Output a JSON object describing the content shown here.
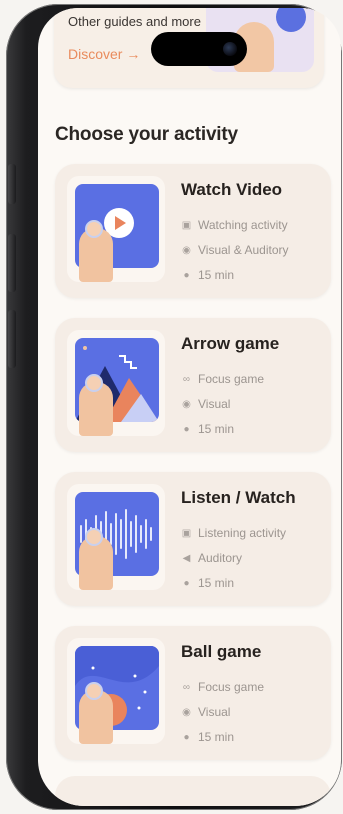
{
  "top_card": {
    "cut_text": "Other guides and more",
    "discover_label": "Discover",
    "arrow_icon": "arrow-right-icon"
  },
  "section_title": "Choose your activity",
  "activities": [
    {
      "title": "Watch Video",
      "thumbnail_icon": "play-video-icon",
      "meta": [
        {
          "icon": "activity-icon",
          "text": "Watching activity"
        },
        {
          "icon": "sense-icon",
          "text": "Visual & Auditory"
        },
        {
          "icon": "clock-icon",
          "text": "15 min"
        }
      ]
    },
    {
      "title": "Arrow game",
      "thumbnail_icon": "mountains-illustration",
      "meta": [
        {
          "icon": "gamepad-icon",
          "text": "Focus game"
        },
        {
          "icon": "sense-icon",
          "text": "Visual"
        },
        {
          "icon": "clock-icon",
          "text": "15 min"
        }
      ]
    },
    {
      "title": "Listen / Watch",
      "thumbnail_icon": "waveform-illustration",
      "meta": [
        {
          "icon": "activity-icon",
          "text": "Listening activity"
        },
        {
          "icon": "speaker-icon",
          "text": "Auditory"
        },
        {
          "icon": "clock-icon",
          "text": "15 min"
        }
      ]
    },
    {
      "title": "Ball game",
      "thumbnail_icon": "ball-illustration",
      "meta": [
        {
          "icon": "gamepad-icon",
          "text": "Focus game"
        },
        {
          "icon": "sense-icon",
          "text": "Visual"
        },
        {
          "icon": "clock-icon",
          "text": "15 min"
        }
      ]
    }
  ],
  "colors": {
    "accent": "#e98b5c",
    "illustration_blue": "#5a6fe3",
    "card_bg": "#f5ede6",
    "screen_bg": "#fcf9f5"
  }
}
